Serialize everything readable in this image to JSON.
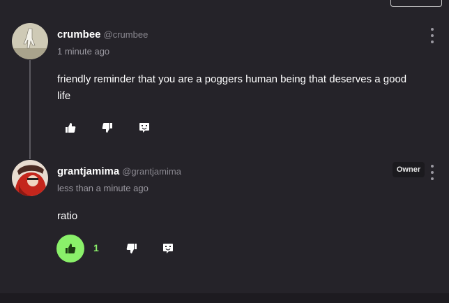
{
  "comments": [
    {
      "username": "crumbee",
      "handle": "@crumbee",
      "timestamp": "1 minute ago",
      "text": "friendly reminder that you are a poggers human being that deserves a good life",
      "like_count": "",
      "liked": false,
      "owner_badge": ""
    },
    {
      "username": "grantjamima",
      "handle": "@grantjamima",
      "timestamp": "less than a minute ago",
      "text": "ratio",
      "like_count": "1",
      "liked": true,
      "owner_badge": "Owner"
    }
  ],
  "colors": {
    "background": "#252329",
    "accent_green": "#8af06a",
    "muted_text": "#9a98a0"
  },
  "icons": [
    "thumbs-up-icon",
    "thumbs-down-icon",
    "reply-icon",
    "more-options-icon"
  ]
}
